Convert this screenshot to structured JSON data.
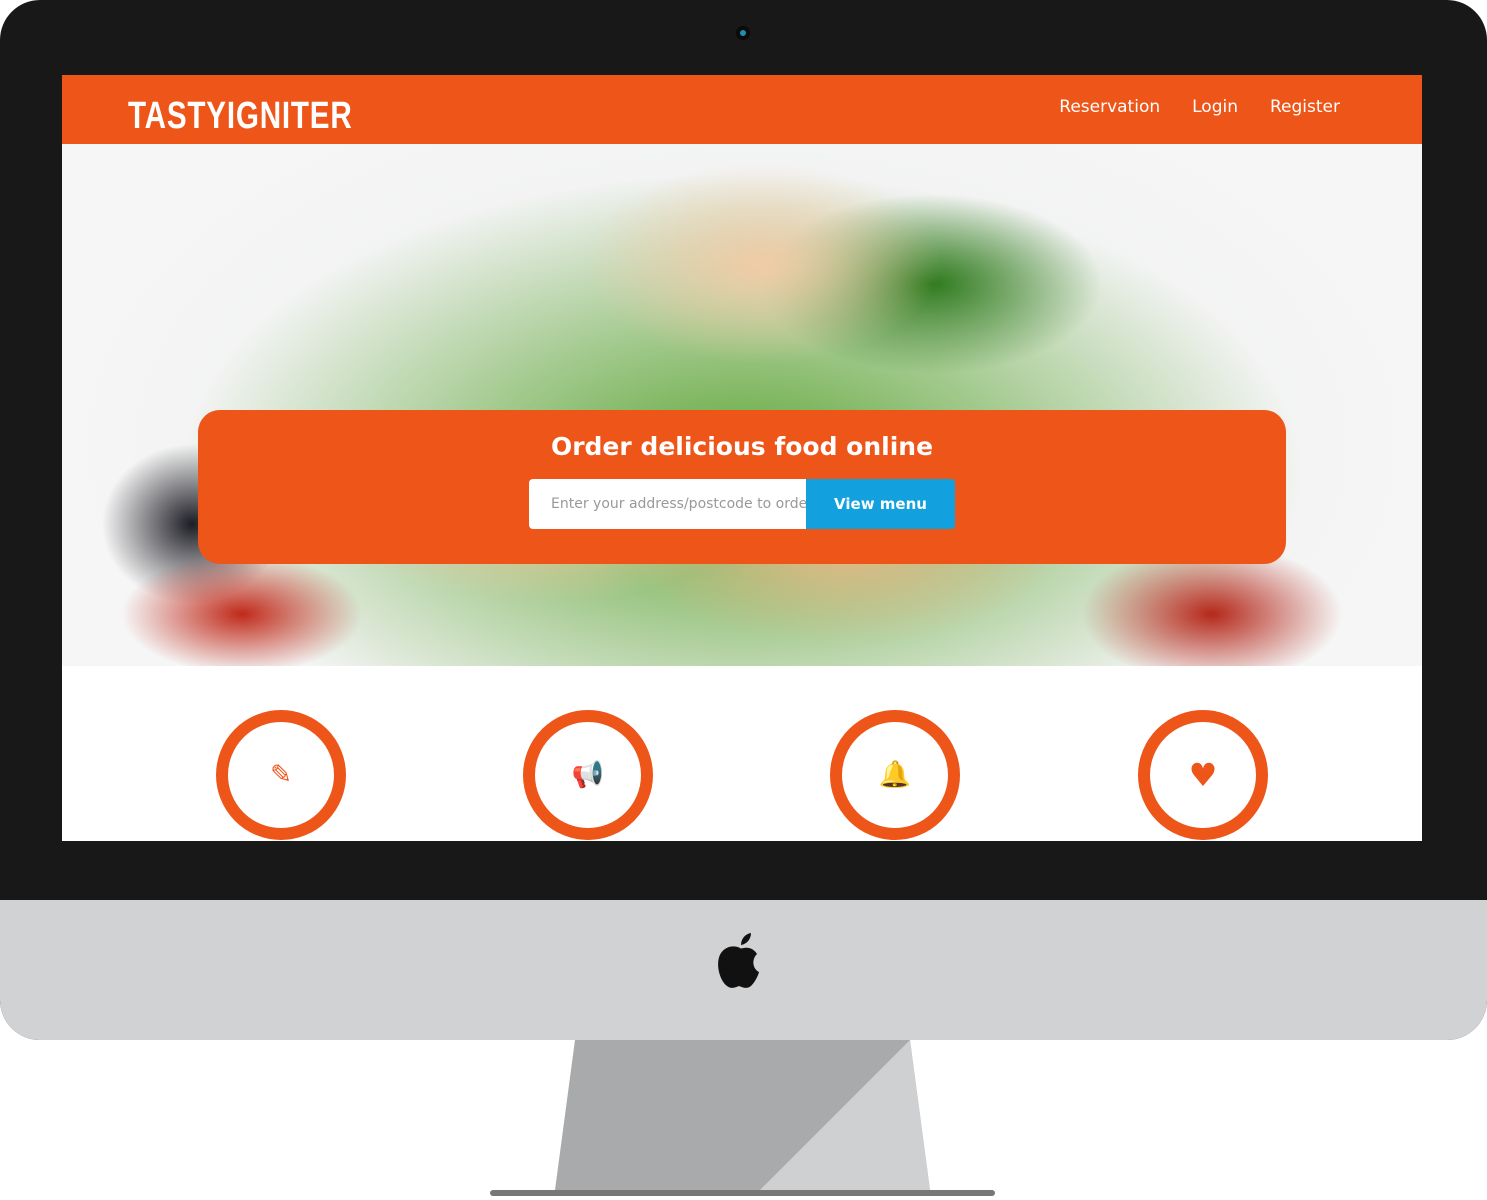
{
  "nav": {
    "logo": "TASTYIGNITER",
    "links": [
      "Reservation",
      "Login",
      "Register"
    ]
  },
  "hero": {
    "title": "Order delicious food online",
    "search_placeholder": "Enter your address/postcode to order",
    "button": "View menu"
  },
  "features": [
    {
      "icon": "pencil-icon",
      "glyph": "✎"
    },
    {
      "icon": "megaphone-icon",
      "glyph": "📢"
    },
    {
      "icon": "bell-icon",
      "glyph": "🔔"
    },
    {
      "icon": "heart-icon",
      "glyph": "♥"
    }
  ],
  "colors": {
    "brand": "#ee5519",
    "button": "#12a1de"
  }
}
